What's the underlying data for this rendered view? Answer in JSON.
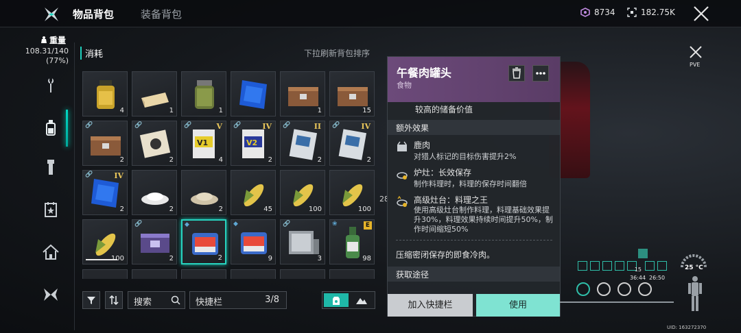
{
  "header": {
    "tabs": [
      {
        "label": "物品背包",
        "active": true
      },
      {
        "label": "装备背包",
        "active": false
      }
    ],
    "currency_a": "8734",
    "currency_b": "182.75K"
  },
  "sidebar": {
    "weight_label": "重量",
    "weight_value": "108.31/140",
    "weight_pct": "(77%)",
    "items": [
      {
        "icon": "wrench-icon"
      },
      {
        "icon": "bottle-icon",
        "active": true
      },
      {
        "icon": "flashlight-icon"
      },
      {
        "icon": "badge-icon"
      },
      {
        "icon": "house-icon"
      },
      {
        "icon": "butterfly-icon"
      }
    ]
  },
  "inventory": {
    "section_title": "消耗",
    "refresh_hint": "下拉刷新背包排序",
    "slots": [
      {
        "art": "oil-bottle",
        "count": "4"
      },
      {
        "art": "cheese",
        "count": "1"
      },
      {
        "art": "pickle-jar",
        "count": "1"
      },
      {
        "art": "blue-card",
        "count": ""
      },
      {
        "art": "crate",
        "count": "1"
      },
      {
        "art": "crate",
        "count": "15"
      },
      {
        "art": "crate",
        "count": "2",
        "link": true
      },
      {
        "art": "ticket",
        "count": "2",
        "link": true
      },
      {
        "art": "vcard-yellow",
        "count": "4",
        "link": true,
        "tier": "V"
      },
      {
        "art": "vcard-blue",
        "count": "2",
        "link": true,
        "tier": "IV"
      },
      {
        "art": "blueprint",
        "count": "2",
        "link": true,
        "tier": "II"
      },
      {
        "art": "blueprint",
        "count": "2",
        "link": true,
        "tier": "IV"
      },
      {
        "art": "blue-card",
        "count": "2",
        "link": true,
        "tier": "IV"
      },
      {
        "art": "salt",
        "count": "2"
      },
      {
        "art": "flour",
        "count": "2"
      },
      {
        "art": "corn",
        "count": "45"
      },
      {
        "art": "corn",
        "count": "100"
      },
      {
        "art": "corn",
        "count": "100"
      },
      {
        "art": "corn",
        "count": "100",
        "dura": true
      },
      {
        "art": "purple-case",
        "count": "2",
        "link": true
      },
      {
        "art": "spam-can",
        "count": "2",
        "shield": true,
        "selected": true
      },
      {
        "art": "spam-can",
        "count": "9",
        "shield": true
      },
      {
        "art": "silver-box",
        "count": "3",
        "link": true
      },
      {
        "art": "soju-bottle",
        "count": "98",
        "flower": true,
        "ebadge": "E"
      }
    ]
  },
  "bottom": {
    "search_label": "搜索",
    "quickbar_label": "快捷栏",
    "quickbar_count": "3/8"
  },
  "detail": {
    "name": "午餐肉罐头",
    "type": "食物",
    "reserve_value": "较高的储备价值",
    "extra_effects_title": "额外效果",
    "effects": [
      {
        "icon": "deer-icon",
        "title": "鹿肉",
        "desc": "对猎人标记的目标伤害提升2%"
      },
      {
        "icon": "stove-icon",
        "title": "炉灶：长效保存",
        "desc": "制作料理时，料理的保存时间翻倍"
      },
      {
        "icon": "crown-stove-icon",
        "title": "高级灶台：料理之王",
        "desc": "使用高级灶台制作料理，料理基础效果提升30%，料理效果持续时间提升50%，制作时间缩短50%"
      }
    ],
    "description": "压缩密闭保存的即食冷肉。",
    "source_title": "获取途径",
    "add_quickbar": "加入快捷栏",
    "use": "使用"
  },
  "hud": {
    "mode": "PVE",
    "temp": "25 °C",
    "stat_a": "36:44",
    "stat_b": "26:50",
    "mini_num": "15",
    "uid": "UID: 163272370",
    "side_num": "28"
  }
}
